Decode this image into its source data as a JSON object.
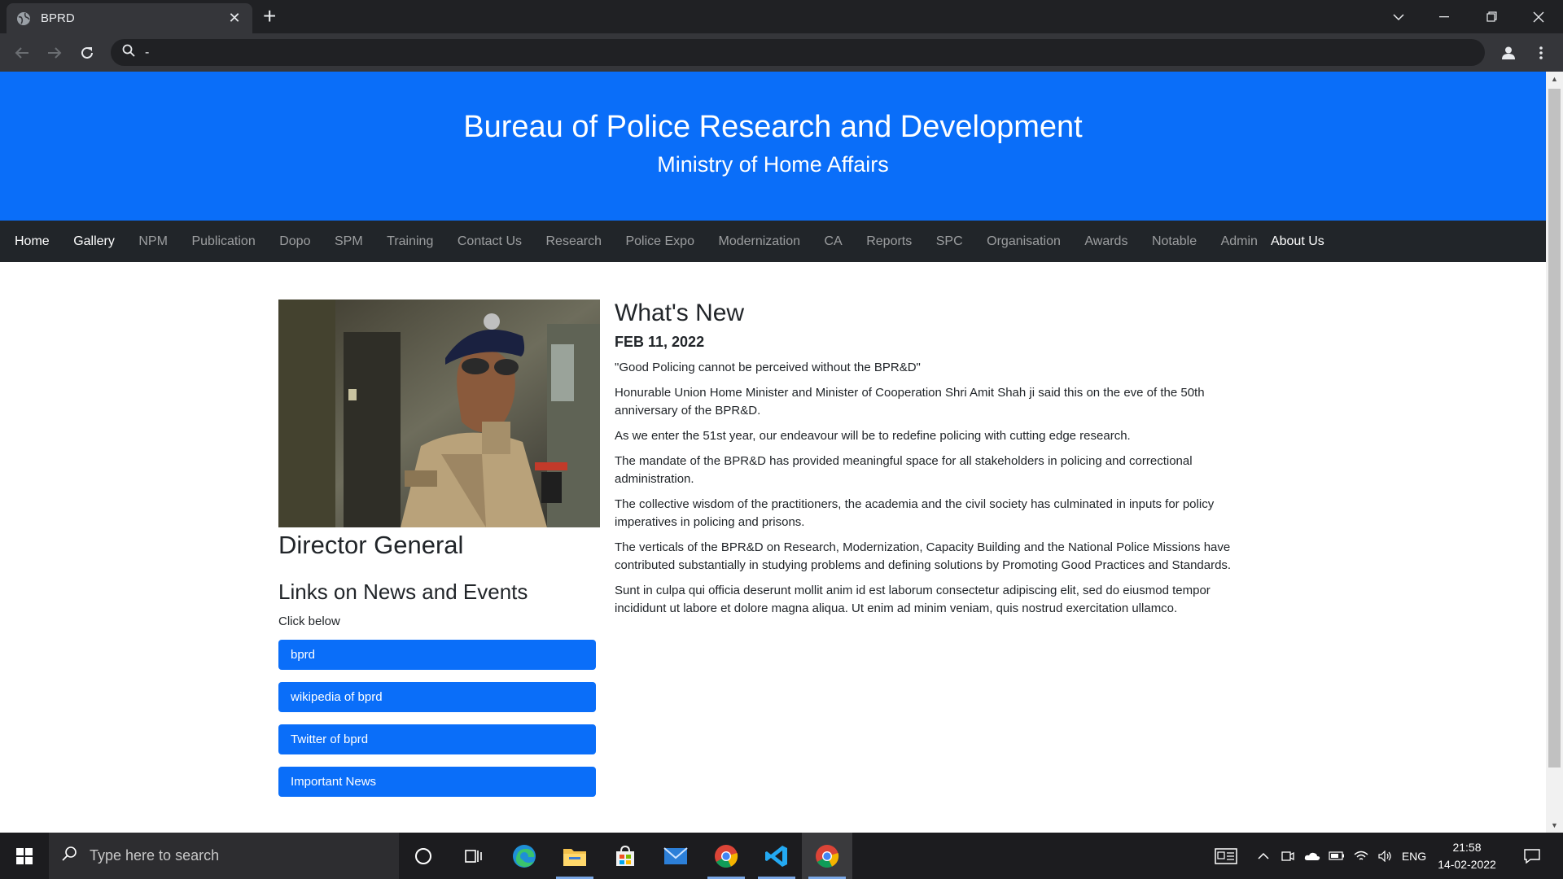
{
  "browser": {
    "tab_title": "BPRD",
    "address": "-"
  },
  "header": {
    "title": "Bureau of Police Research and Development",
    "subtitle": "Ministry of Home Affairs"
  },
  "nav": {
    "items": [
      "Home",
      "Gallery",
      "NPM",
      "Publication",
      "Dopo",
      "SPM",
      "Training",
      "Contact Us",
      "Research",
      "Police Expo",
      "Modernization",
      "CA",
      "Reports",
      "SPC",
      "Organisation",
      "Awards",
      "Notable",
      "Admin",
      "About Us"
    ]
  },
  "sidebar": {
    "caption": "Director General",
    "links_heading": "Links on News and Events",
    "click_below": "Click below",
    "links": [
      "bprd",
      "wikipedia of bprd",
      "Twitter of bprd",
      "Important News"
    ]
  },
  "news": {
    "heading": "What's New",
    "date": "FEB 11, 2022",
    "paragraphs": [
      "\"Good Policing cannot be perceived without the BPR&D\"",
      "Honurable Union Home Minister and Minister of Cooperation Shri Amit Shah ji said this on the eve of the 50th anniversary of the BPR&D.",
      "As we enter the 51st year, our endeavour will be to redefine policing with cutting edge research.",
      "The mandate of the BPR&D has provided meaningful space for all stakeholders in policing and correctional administration.",
      "The collective wisdom of the practitioners, the academia and the civil society has culminated in inputs for policy imperatives in policing and prisons.",
      "The verticals of the BPR&D on Research, Modernization, Capacity Building and the National Police Missions have contributed substantially in studying problems and defining solutions by Promoting Good Practices and Standards.",
      "Sunt in culpa qui officia deserunt mollit anim id est laborum consectetur adipiscing elit, sed do eiusmod tempor incididunt ut labore et dolore magna aliqua. Ut enim ad minim veniam, quis nostrud exercitation ullamco."
    ]
  },
  "taskbar": {
    "search_placeholder": "Type here to search",
    "language": "ENG",
    "time": "21:58",
    "date": "14-02-2022"
  },
  "colors": {
    "accent": "#0a6ef9",
    "navbar": "#212529"
  }
}
